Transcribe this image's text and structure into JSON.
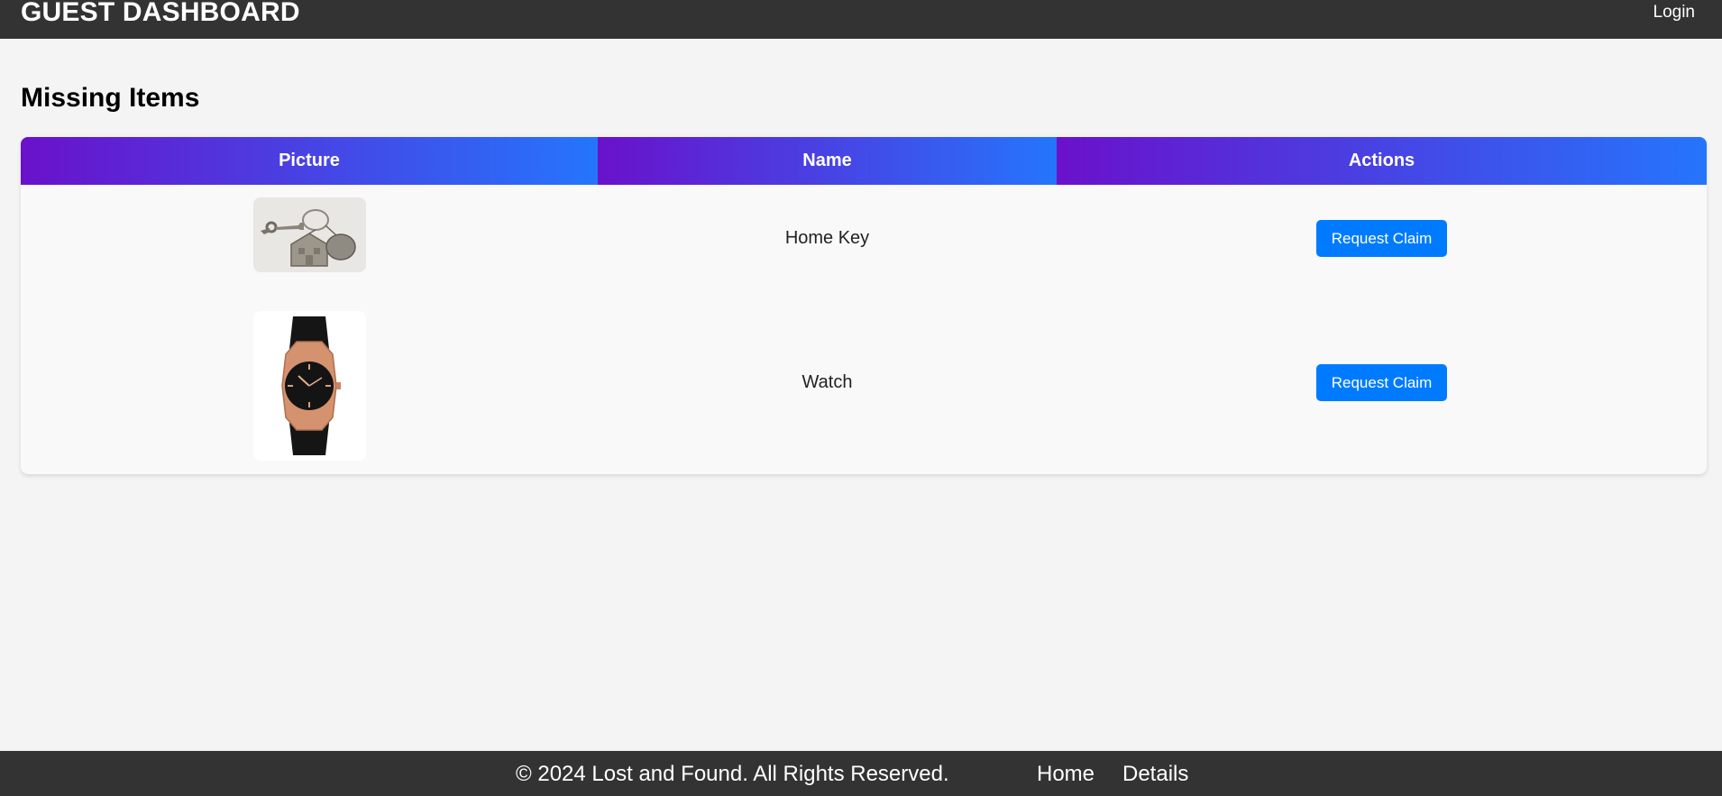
{
  "header": {
    "title": "GUEST DASHBOARD",
    "login_label": "Login"
  },
  "main": {
    "heading": "Missing Items",
    "columns": [
      "Picture",
      "Name",
      "Actions"
    ],
    "items": [
      {
        "name": "Home Key",
        "picture_icon": "house-keychain-icon",
        "action_label": "Request Claim"
      },
      {
        "name": "Watch",
        "picture_icon": "wristwatch-icon",
        "action_label": "Request Claim"
      }
    ]
  },
  "footer": {
    "copyright": "© 2024 Lost and Found. All Rights Reserved.",
    "links": [
      "Home",
      "Details"
    ]
  },
  "colors": {
    "header_bg": "#333333",
    "page_bg": "#f4f4f4",
    "gradient_start": "#6a11cb",
    "gradient_end": "#2575fc",
    "button_bg": "#007bff"
  }
}
